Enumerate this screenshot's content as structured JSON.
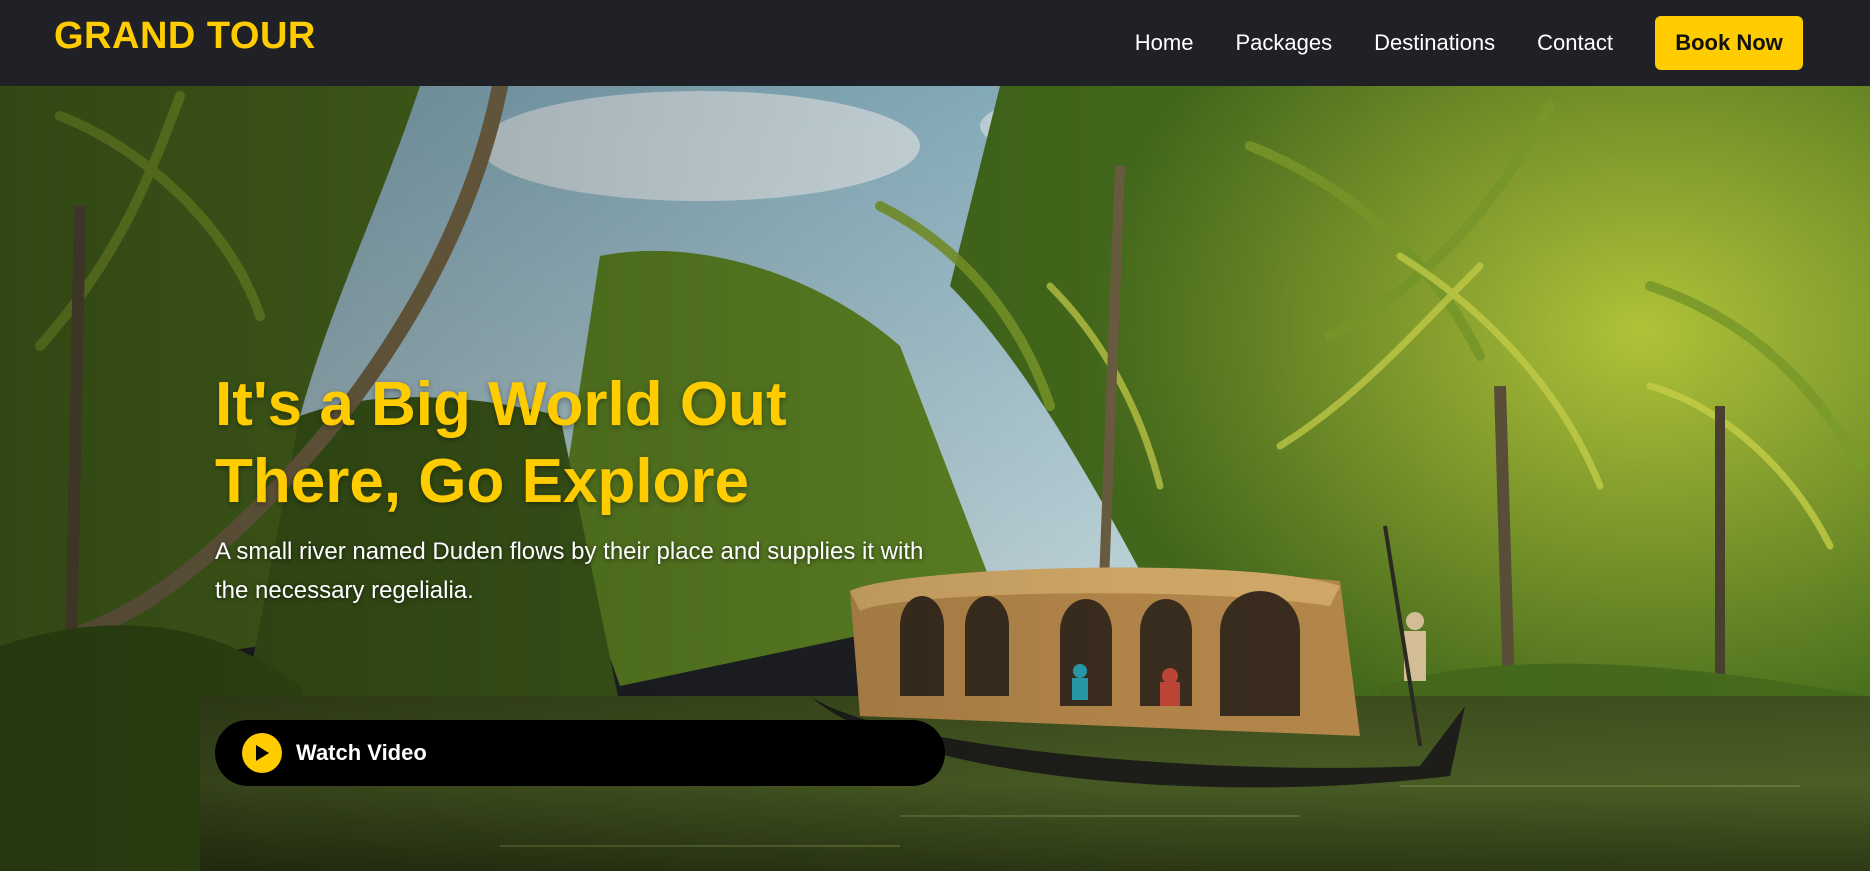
{
  "brand": {
    "name": "GRAND TOUR",
    "color": "#ffcc00"
  },
  "nav": {
    "items": [
      {
        "label": "Home"
      },
      {
        "label": "Packages"
      },
      {
        "label": "Destinations"
      },
      {
        "label": "Contact"
      }
    ],
    "cta_label": "Book Now"
  },
  "hero": {
    "title_line1": "It's a Big World Out",
    "title_line2": "There, Go Explore",
    "subtitle": "A small river named Duden flows by their place and supplies it with the necessary regelialia.",
    "watch_label": "Watch Video",
    "image_description_icon": "houseboat-backwaters-photo",
    "play_icon": "play-icon"
  },
  "colors": {
    "accent": "#ffcc00",
    "navbar_bg": "#1f2126",
    "button_dark": "#000000"
  }
}
